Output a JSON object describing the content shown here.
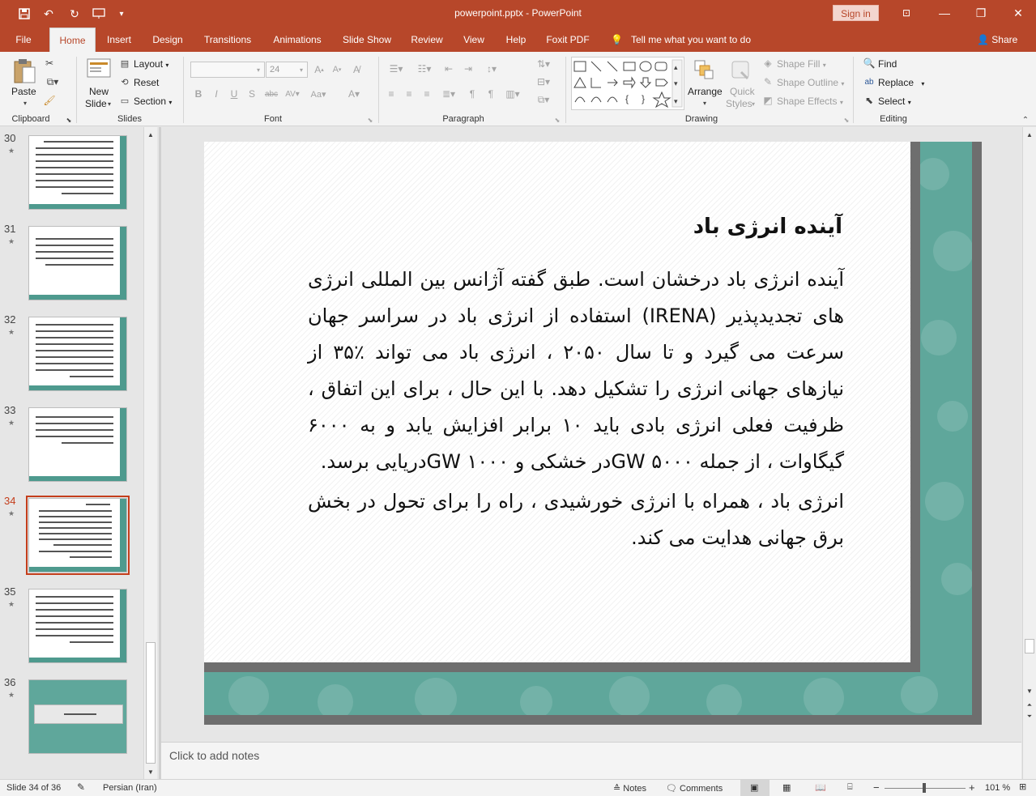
{
  "app": {
    "file_title": "powerpoint.pptx - PowerPoint",
    "sign_in": "Sign in",
    "accent": "#b7472a"
  },
  "quick_access": {
    "icons": [
      "save-icon",
      "undo-icon",
      "redo-icon",
      "present-from-start-icon",
      "customize-qat-icon"
    ]
  },
  "window": {
    "minimize": "—",
    "restore": "❐",
    "close": "✕",
    "ribbon_display": "⊡"
  },
  "tabs": [
    {
      "label": "File"
    },
    {
      "label": "Home"
    },
    {
      "label": "Insert"
    },
    {
      "label": "Design"
    },
    {
      "label": "Transitions"
    },
    {
      "label": "Animations"
    },
    {
      "label": "Slide Show"
    },
    {
      "label": "Review"
    },
    {
      "label": "View"
    },
    {
      "label": "Help"
    },
    {
      "label": "Foxit PDF"
    }
  ],
  "tell_me": "Tell me what you want to do",
  "share": "Share",
  "ribbon": {
    "clipboard": {
      "paste": "Paste",
      "label": "Clipboard"
    },
    "slides": {
      "new_slide_1": "New",
      "new_slide_2": "Slide",
      "layout": "Layout",
      "reset": "Reset",
      "section": "Section",
      "label": "Slides"
    },
    "font": {
      "font_name": "",
      "font_size": "24",
      "label": "Font"
    },
    "paragraph": {
      "label": "Paragraph"
    },
    "drawing": {
      "arrange": "Arrange",
      "quick_styles_1": "Quick",
      "quick_styles_2": "Styles",
      "shape_fill": "Shape Fill",
      "shape_outline": "Shape Outline",
      "shape_effects": "Shape Effects",
      "label": "Drawing"
    },
    "editing": {
      "find": "Find",
      "replace": "Replace",
      "select": "Select",
      "label": "Editing"
    }
  },
  "thumbnails": [
    {
      "num": "30",
      "selected": false
    },
    {
      "num": "31",
      "selected": false
    },
    {
      "num": "32",
      "selected": false
    },
    {
      "num": "33",
      "selected": false
    },
    {
      "num": "34",
      "selected": true
    },
    {
      "num": "35",
      "selected": false
    },
    {
      "num": "36",
      "selected": false
    }
  ],
  "slide": {
    "title": "آینده انرژی باد",
    "paragraph1": "آینده انرژی باد درخشان است. طبق گفته آژانس بین المللی انرژی های تجدیدپذیر (IRENA) استفاده از انرژی باد در سراسر جهان سرعت می گیرد و تا سال ۲۰۵۰ ، انرژی باد می تواند ٪۳۵ از نیازهای جهانی انرژی را تشکیل دهد. با این حال ، برای این اتفاق ، ظرفیت فعلی انرژی بادی باید ۱۰ برابر افزایش یابد و به ۶۰۰۰ گیگاوات ، از جمله ۵۰۰۰ GWدر خشکی و ۱۰۰۰ GWدریایی برسد.",
    "paragraph2": "انرژی باد ، همراه با انرژی خورشیدی ، راه را برای تحول در بخش برق جهانی هدایت می کند."
  },
  "notes_placeholder": "Click to add notes",
  "status": {
    "slide_count": "Slide 34 of 36",
    "language": "Persian (Iran)",
    "notes": "Notes",
    "comments": "Comments",
    "zoom": "101 %"
  }
}
